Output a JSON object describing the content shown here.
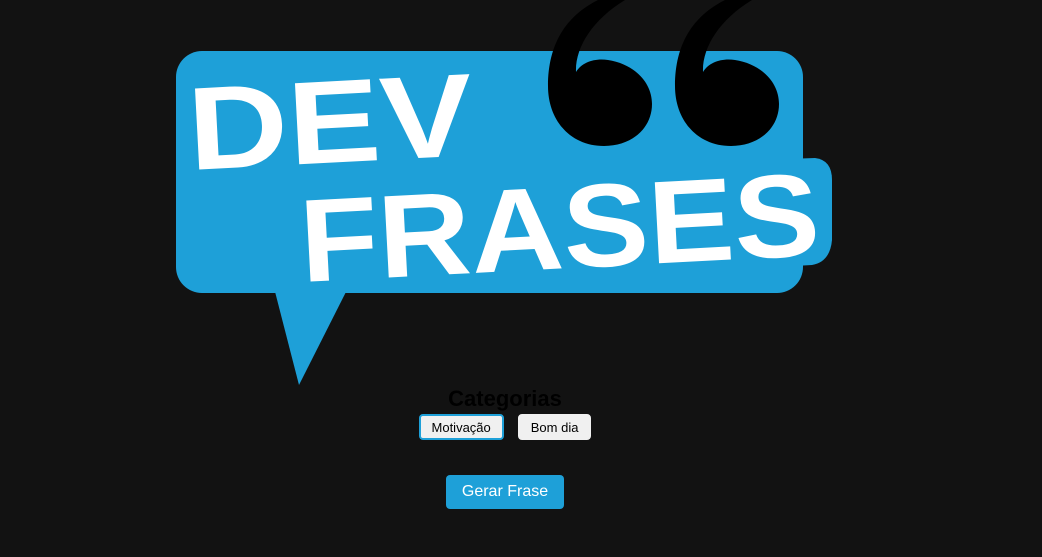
{
  "logo": {
    "line1": "DEV",
    "line2": "FRASES",
    "bubble_color": "#1ea0d8",
    "quote_color": "#000000",
    "text_color": "#ffffff"
  },
  "categories": {
    "title": "Categorias",
    "items": [
      {
        "label": "Motivação",
        "selected": true
      },
      {
        "label": "Bom dia",
        "selected": false
      }
    ]
  },
  "generate_button": {
    "label": "Gerar Frase",
    "color": "#1ea0d8"
  }
}
